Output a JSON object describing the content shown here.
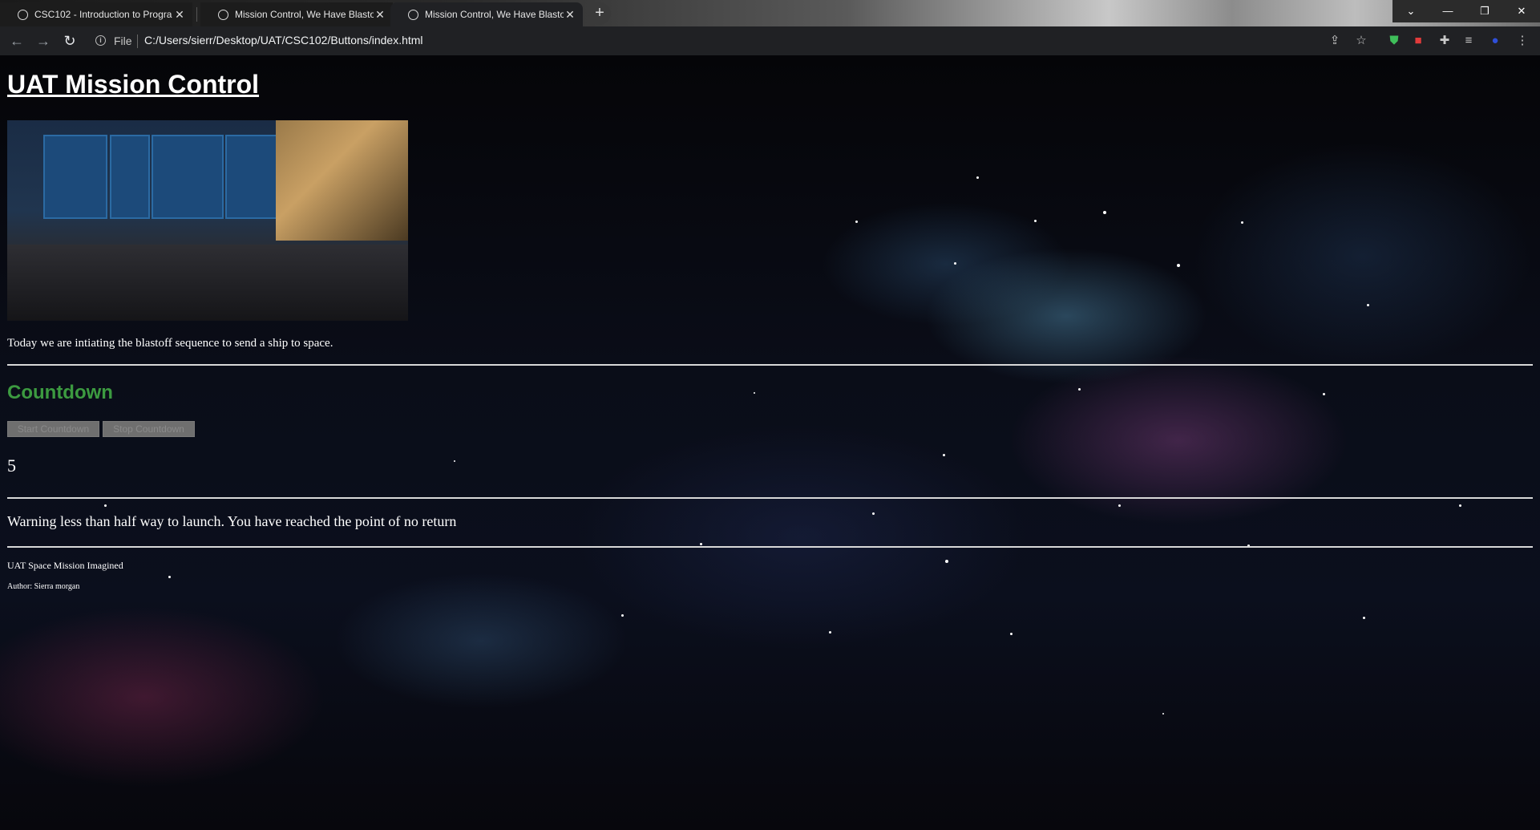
{
  "browser": {
    "tabs": [
      {
        "title": "CSC102 - Introduction to Progra",
        "active": false
      },
      {
        "title": "Mission Control, We Have Blastof",
        "active": false
      },
      {
        "title": "Mission Control, We Have Blasto",
        "active": true
      }
    ],
    "close_glyph": "✕",
    "new_tab_glyph": "+",
    "address": {
      "security_label": "File",
      "url": "C:/Users/sierr/Desktop/UAT/CSC102/Buttons/index.html"
    }
  },
  "page": {
    "title": "UAT Mission Control",
    "intro": "Today we are intiating the blastoff sequence to send a ship to space.",
    "countdown_heading": "Countdown",
    "buttons": {
      "start": "Start Countdown",
      "stop": "Stop Countdown"
    },
    "countdown_value": "5",
    "warning": "Warning less than half way to launch. You have reached the point of no return",
    "footer": {
      "title": "UAT Space Mission Imagined",
      "author": "Author: Sierra morgan"
    }
  },
  "colors": {
    "heading_green": "#3c9a40",
    "button_disabled": "#6f6f6f",
    "chrome_toolbar": "#202124"
  },
  "icons": [
    "chrome-globe-icon",
    "close-icon",
    "new-tab-icon",
    "back-icon",
    "forward-icon",
    "reload-icon",
    "info-icon",
    "share-icon",
    "bookmark-star-icon",
    "extension-icon",
    "menu-icon"
  ]
}
